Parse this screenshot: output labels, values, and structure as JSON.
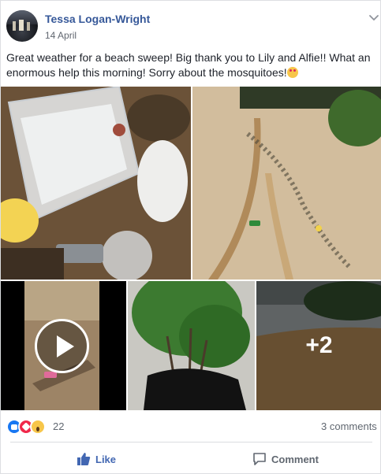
{
  "post": {
    "author": "Tessa Logan-Wright",
    "date": "14 April",
    "text": "Great weather for a beach sweep! Big thank you to Lily and Alfie!! What an enormous help this morning! Sorry about the mosquitoes!",
    "more_photos_label": "+2",
    "reaction_count": "22",
    "comments_label": "3 comments"
  },
  "actions": {
    "like_label": "Like",
    "comment_label": "Comment"
  },
  "colors": {
    "author_link": "#365899",
    "like_blue": "#4267b2",
    "love_red": "#f0284a",
    "wow_yellow": "#f7c64a"
  },
  "icons": [
    "chevron-down-icon",
    "play-icon",
    "like-reaction-icon",
    "love-reaction-icon",
    "wow-reaction-icon",
    "thumbs-up-icon",
    "comment-icon",
    "flushed-face-emoji"
  ]
}
